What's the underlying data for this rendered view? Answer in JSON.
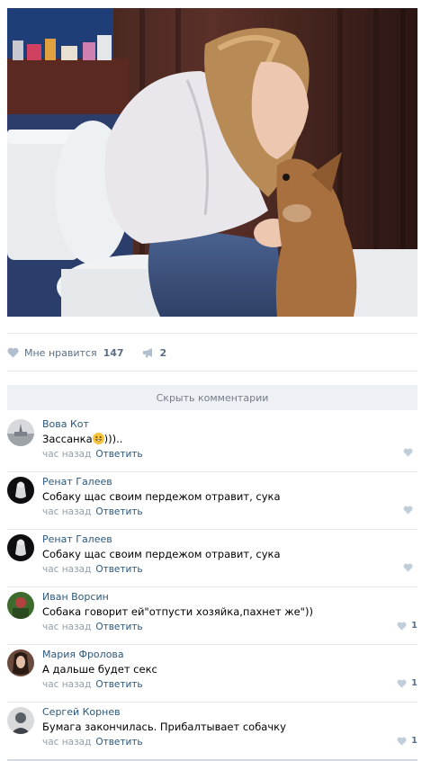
{
  "post": {
    "likes_label": "Мне нравится",
    "likes_count": "147",
    "shares_count": "2"
  },
  "comments_toggle": "Скрыть комментарии",
  "comments": [
    {
      "author": "Вова Кот",
      "text": "Зассанка",
      "text_suffix": ")))..",
      "emoji": "grinning-emoji",
      "time": "час назад",
      "reply": "Ответить",
      "likes": ""
    },
    {
      "author": "Ренат Галеев",
      "text": "Собаку щас своим пердежом отравит, сука",
      "time": "час назад",
      "reply": "Ответить",
      "likes": ""
    },
    {
      "author": "Ренат Галеев",
      "text": "Собаку щас своим пердежом отравит, сука",
      "time": "час назад",
      "reply": "Ответить",
      "likes": ""
    },
    {
      "author": "Иван Ворсин",
      "text": "Собака говорит ей\"отпусти хозяйка,пахнет же\"))",
      "time": "час назад",
      "reply": "Ответить",
      "likes": "1"
    },
    {
      "author": "Мария Фролова",
      "text": "А дальше будет секс",
      "time": "час назад",
      "reply": "Ответить",
      "likes": "1"
    },
    {
      "author": "Сергей Корнев",
      "text": "Бумага закончилась. Прибалтывает собачку",
      "time": "час назад",
      "reply": "Ответить",
      "likes": "1"
    }
  ],
  "icons": {
    "like": "heart-icon",
    "share": "megaphone-icon"
  },
  "colors": {
    "link": "#2b587a",
    "muted": "#939da8",
    "action": "#5b6f86",
    "toggle_bg": "#edf0f4"
  }
}
